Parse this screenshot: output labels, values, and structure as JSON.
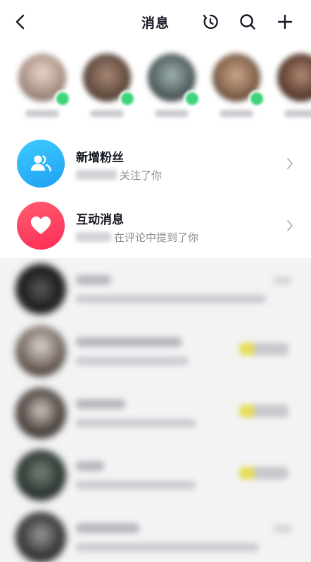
{
  "header": {
    "title": "消息",
    "icons": [
      "back-icon",
      "history-icon",
      "search-icon",
      "plus-icon"
    ]
  },
  "stories": {
    "items": [
      {
        "label": "",
        "online": true,
        "avatar_color": "#b89f94"
      },
      {
        "label": "",
        "online": true,
        "avatar_color": "#6e5648"
      },
      {
        "label": "",
        "online": true,
        "avatar_color": "#5f6b6d"
      },
      {
        "label": "",
        "online": true,
        "avatar_color": "#8d6d55"
      },
      {
        "label": "",
        "online": false,
        "avatar_color": "#6a4a3b"
      }
    ]
  },
  "notifications": {
    "new_fans": {
      "title": "新增粉丝",
      "subtitle": "关注了你",
      "icon": "followers-icon",
      "color": "#25a9f5"
    },
    "interactions": {
      "title": "互动消息",
      "subtitle": "在评论中提到了你",
      "icon": "heart-icon",
      "color": "#fe2c55"
    }
  },
  "colors": {
    "accent_green": "#3fd47a",
    "text_primary": "#161823",
    "text_secondary": "#8a8b91"
  }
}
